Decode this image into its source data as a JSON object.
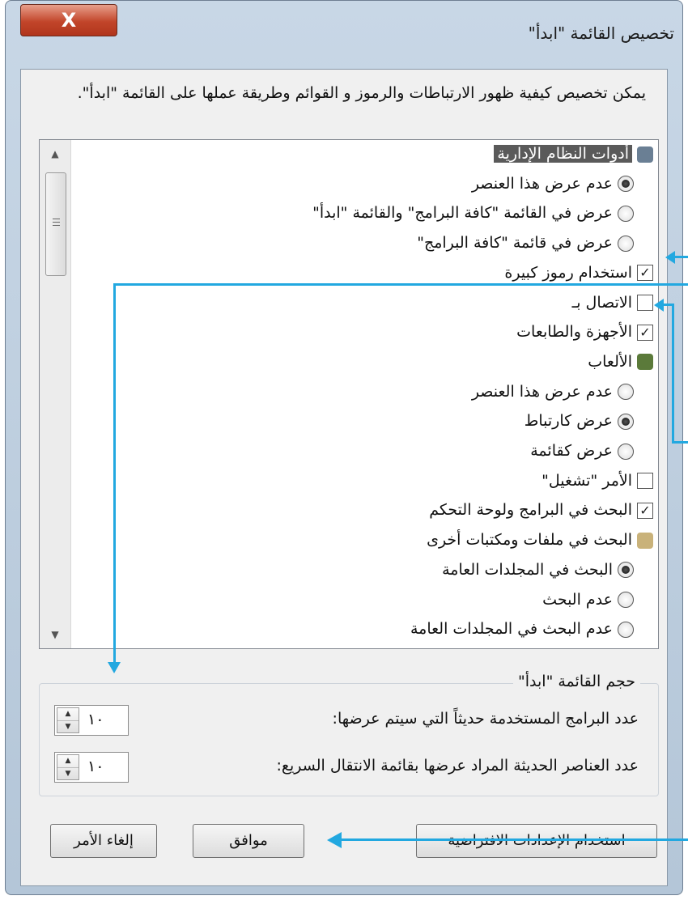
{
  "window": {
    "title": "تخصيص القائمة \"ابدأ\"",
    "close_label": "X"
  },
  "description": "يمكن تخصيص كيفية ظهور الارتباطات والرموز و القوائم وطريقة عملها على القائمة \"ابدأ\".",
  "list_items": [
    {
      "kind": "category",
      "label": "أدوات النظام الإدارية",
      "icon": "admin-tools-icon",
      "selected": true
    },
    {
      "kind": "radio",
      "label": "عدم عرض هذا العنصر",
      "checked": true
    },
    {
      "kind": "radio",
      "label": "عرض في القائمة \"كافة البرامج\" والقائمة \"ابدأ\"",
      "checked": false
    },
    {
      "kind": "radio",
      "label": "عرض في قائمة \"كافة البرامج\"",
      "checked": false
    },
    {
      "kind": "checkbox",
      "label": "استخدام رموز كبيرة",
      "checked": true
    },
    {
      "kind": "checkbox",
      "label": "الاتصال بـ",
      "checked": false
    },
    {
      "kind": "checkbox",
      "label": "الأجهزة والطابعات",
      "checked": true
    },
    {
      "kind": "category",
      "label": "الألعاب",
      "icon": "games-icon",
      "selected": false
    },
    {
      "kind": "radio",
      "label": "عدم عرض هذا العنصر",
      "checked": false
    },
    {
      "kind": "radio",
      "label": "عرض كارتباط",
      "checked": true
    },
    {
      "kind": "radio",
      "label": "عرض كقائمة",
      "checked": false
    },
    {
      "kind": "checkbox",
      "label": "الأمر \"تشغيل\"",
      "checked": false
    },
    {
      "kind": "checkbox",
      "label": "البحث في البرامج ولوحة التحكم",
      "checked": true
    },
    {
      "kind": "category",
      "label": "البحث في ملفات ومكتبات أخرى",
      "icon": "search-files-icon",
      "selected": false
    },
    {
      "kind": "radio",
      "label": "البحث في المجلدات العامة",
      "checked": true
    },
    {
      "kind": "radio",
      "label": "عدم البحث",
      "checked": false
    },
    {
      "kind": "radio",
      "label": "عدم البحث في المجلدات العامة",
      "checked": false
    }
  ],
  "start_menu_size": {
    "title": "حجم القائمة \"ابدأ\"",
    "recent_programs_label": "عدد البرامج المستخدمة حديثاً التي سيتم عرضها:",
    "recent_programs_value": "١٠",
    "jump_list_label": "عدد العناصر الحديثة المراد عرضها بقائمة الانتقال السريع:",
    "jump_list_value": "١٠"
  },
  "buttons": {
    "defaults": "استخدام الإعدادات الافتراضية",
    "ok": "موافق",
    "cancel": "إلغاء الأمر"
  },
  "colors": {
    "annotation_arrow": "#22a8e0",
    "selected_highlight": "#5a5a5a"
  }
}
